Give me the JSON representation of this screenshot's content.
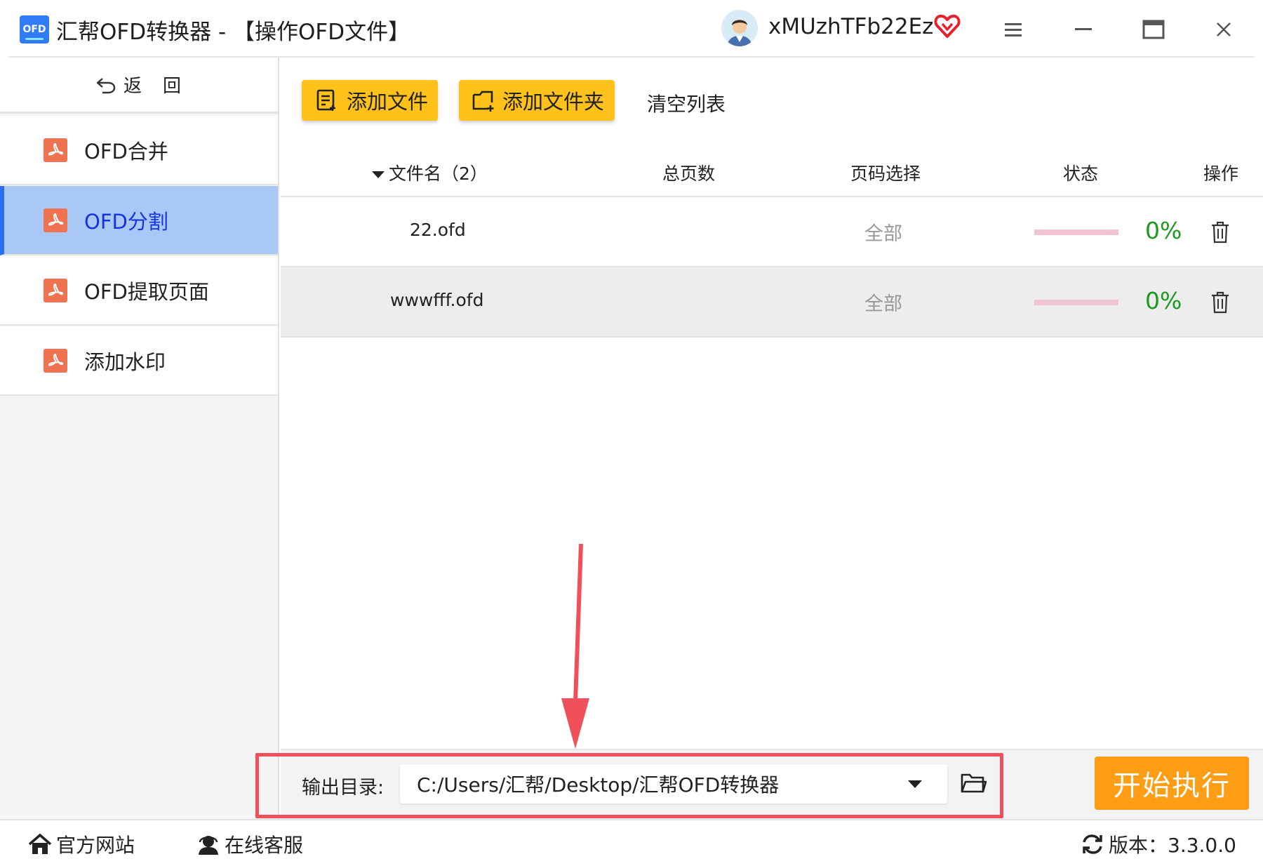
{
  "titlebar": {
    "logo_text": "OFD",
    "title": "汇帮OFD转换器 - 【操作OFD文件】",
    "username": "xMUzhTFb22Ez",
    "icons": [
      "avatar",
      "vip-heart-icon",
      "menu-icon",
      "minimize-icon",
      "maximize-icon",
      "close-icon"
    ]
  },
  "sidebar": {
    "back_label": "返　回",
    "items": [
      {
        "label": "OFD合并",
        "icon": "pdf-icon",
        "active": false
      },
      {
        "label": "OFD分割",
        "icon": "pdf-icon",
        "active": true
      },
      {
        "label": "OFD提取页面",
        "icon": "pdf-icon",
        "active": false
      },
      {
        "label": "添加水印",
        "icon": "pdf-icon",
        "active": false
      }
    ]
  },
  "toolbar": {
    "add_file": "添加文件",
    "add_folder": "添加文件夹",
    "clear_list": "清空列表"
  },
  "table": {
    "headers": {
      "filename": "文件名（2）",
      "total_pages": "总页数",
      "page_select": "页码选择",
      "status": "状态",
      "action": "操作"
    },
    "rows": [
      {
        "filename": "22.ofd",
        "total_pages": "",
        "page_select": "全部",
        "progress": 0,
        "progress_text": "0%"
      },
      {
        "filename": "wwwfff.ofd",
        "total_pages": "",
        "page_select": "全部",
        "progress": 0,
        "progress_text": "0%"
      }
    ]
  },
  "output": {
    "label": "输出目录:",
    "path": "C:/Users/汇帮/Desktop/汇帮OFD转换器",
    "start_button": "开始执行"
  },
  "footer": {
    "website": "官方网站",
    "support": "在线客服",
    "version": "版本：3.3.0.0"
  },
  "colors": {
    "accent_yellow": "#ffc21a",
    "start_orange": "#ff9d14",
    "active_nav_bg": "#a9c8f6",
    "active_nav_text": "#1733e0",
    "progress_green": "#1c9a1c",
    "annotation_red": "#f0505a"
  }
}
